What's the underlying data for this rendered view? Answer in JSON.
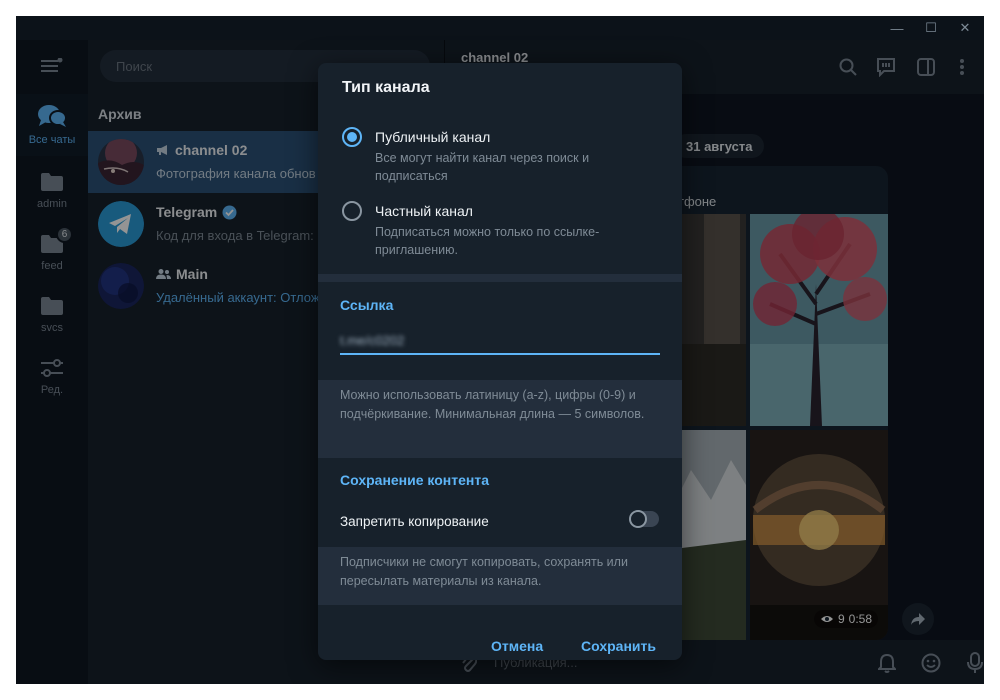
{
  "window": {
    "controls": {
      "minimize": "—",
      "maximize": "☐",
      "close": "✕"
    }
  },
  "folders": [
    {
      "label": "Все чаты",
      "icon": "chat-bubbles-icon",
      "active": true
    },
    {
      "label": "admin",
      "icon": "folder-icon"
    },
    {
      "label": "feed",
      "icon": "folder-icon",
      "badge": "6"
    },
    {
      "label": "svcs",
      "icon": "folder-icon"
    },
    {
      "label": "Ред.",
      "icon": "edit-sliders-icon"
    }
  ],
  "chat_list": {
    "search_placeholder": "Поиск",
    "section_title": "Архив",
    "chats": [
      {
        "name": "channel 02",
        "preview": "Фотография канала обнов",
        "type": "channel",
        "selected": true
      },
      {
        "name": "Telegram",
        "preview": "Код для входа в Telegram: ",
        "verified": true
      },
      {
        "name": "Main",
        "preview": "Удалённый аккаунт: Отлож",
        "type": "group"
      }
    ]
  },
  "chat": {
    "title": "channel 02",
    "date_pill": "31 августа",
    "post_caption": "тфоне",
    "views": "9",
    "video_duration": "0:58",
    "composer_placeholder": "Публикация..."
  },
  "modal": {
    "title": "Тип канала",
    "public_label": "Публичный канал",
    "public_desc": "Все могут найти канал через поиск и подписаться",
    "private_label": "Частный канал",
    "private_desc": "Подписаться можно только по ссылке-приглашению.",
    "link_section": "Ссылка",
    "link_value": "t.me/c0202",
    "link_note": "Можно использовать латиницу (a-z), цифры (0-9) и подчёркивание. Минимальная длина — 5 символов.",
    "content_section": "Сохранение контента",
    "protect_label": "Запретить копирование",
    "protect_note": "Подписчики не смогут копировать, сохранять или пересылать материалы из канала.",
    "cancel": "Отмена",
    "save": "Сохранить"
  },
  "colors": {
    "accent": "#5eb5f7",
    "selected_chat": "#2b5278",
    "panel": "#17212b",
    "background": "#0e1621"
  }
}
